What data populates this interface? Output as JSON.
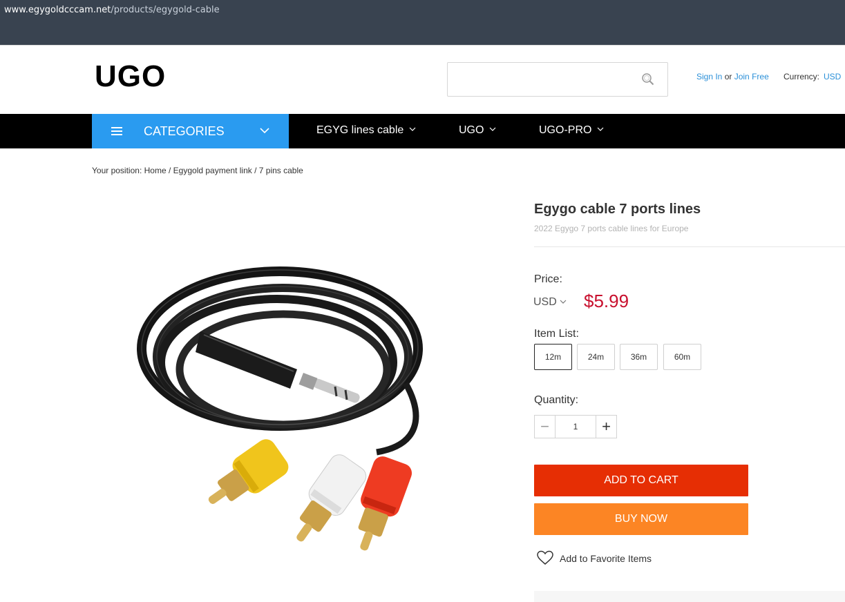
{
  "browser": {
    "url_host": "www.egygoldcccam.net",
    "url_path": "/products/egygold-cable"
  },
  "header": {
    "logo": "UGO",
    "search": {
      "placeholder": ""
    },
    "sign_in": "Sign In",
    "or": "or",
    "join": "Join Free",
    "currency_label": "Currency:",
    "currency_value": "USD"
  },
  "nav": {
    "categories_label": "CATEGORIES",
    "items": [
      {
        "label": "EGYG lines cable"
      },
      {
        "label": "UGO"
      },
      {
        "label": "UGO-PRO"
      }
    ]
  },
  "breadcrumb": {
    "prefix": "Your position:",
    "home": "Home",
    "sep": "/",
    "category": "Egygold payment link",
    "current": "7 pins cable"
  },
  "product": {
    "title": "Egygo cable 7 ports lines",
    "subtitle": "2022 Egygo 7 ports cable lines for Europe",
    "price_label": "Price:",
    "currency": "USD",
    "price": "$5.99",
    "item_list_label": "Item List:",
    "options": [
      "12m",
      "24m",
      "36m",
      "60m"
    ],
    "selected_option": "12m",
    "quantity_label": "Quantity:",
    "quantity": "1",
    "add_to_cart": "ADD TO CART",
    "buy_now": "BUY NOW",
    "favorite": "Add to Favorite Items"
  },
  "colors": {
    "categories_bg": "#2a9bf0",
    "price": "#c8102e",
    "add_to_cart": "#e62e04",
    "buy_now": "#fc8524",
    "link": "#2a8fd8"
  },
  "icons": [
    "search-icon",
    "menu-icon",
    "chevron-down-icon",
    "heart-icon",
    "minus-icon",
    "plus-icon"
  ]
}
